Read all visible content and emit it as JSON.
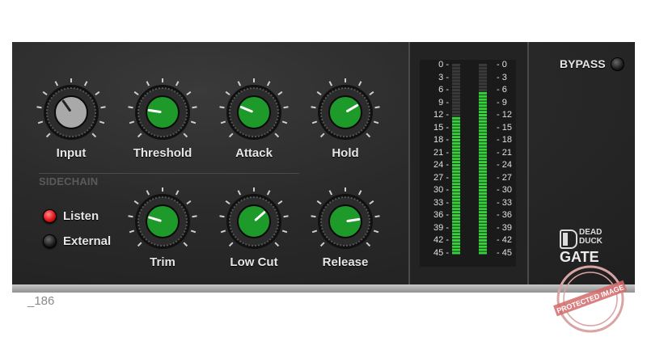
{
  "knobs": {
    "input": {
      "label": "Input",
      "color": "gray",
      "value": 0.37
    },
    "threshold": {
      "label": "Threshold",
      "color": "green",
      "value": 0.2
    },
    "attack": {
      "label": "Attack",
      "color": "green",
      "value": 0.25
    },
    "hold": {
      "label": "Hold",
      "color": "green",
      "value": 0.72
    },
    "trim": {
      "label": "Trim",
      "color": "green",
      "value": 0.23
    },
    "lowcut": {
      "label": "Low Cut",
      "color": "green",
      "value": 0.68
    },
    "release": {
      "label": "Release",
      "color": "green",
      "value": 0.8
    }
  },
  "sidechain": {
    "title": "SIDECHAIN",
    "listen": {
      "label": "Listen",
      "state": "on"
    },
    "external": {
      "label": "External",
      "state": "off"
    }
  },
  "meter": {
    "scale_left": [
      "0 -",
      "3 -",
      "6 -",
      "9 -",
      "12 -",
      "15 -",
      "18 -",
      "21 -",
      "24 -",
      "27 -",
      "30 -",
      "33 -",
      "36 -",
      "39 -",
      "42 -",
      "45 -"
    ],
    "scale_right": [
      "- 0",
      "- 3",
      "- 6",
      "- 9",
      "- 12",
      "- 15",
      "- 18",
      "- 21",
      "- 24",
      "- 27",
      "- 30",
      "- 33",
      "- 36",
      "- 39",
      "- 42",
      "- 45"
    ],
    "level_left_db": 12,
    "level_right_db": 6
  },
  "bypass": {
    "label": "BYPASS",
    "state": "off"
  },
  "brand": {
    "logo_text": "DEAD DUCK",
    "product": "GATE"
  },
  "footer": {
    "code": "_186"
  },
  "stamp": {
    "text": "PROTECTED IMAGE"
  },
  "colors": {
    "knob_green": "#1e9a2a",
    "meter_green": "#35d13a",
    "led_red": "#e0151a"
  }
}
